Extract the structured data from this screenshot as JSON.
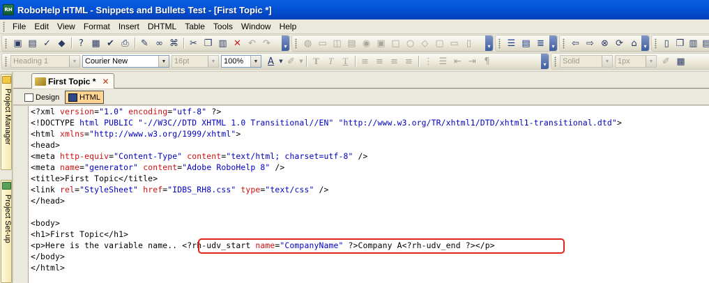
{
  "window": {
    "app_icon_text": "RH",
    "title": "RoboHelp HTML - Snippets and Bullets Test - [First Topic *]"
  },
  "menu": [
    "File",
    "Edit",
    "View",
    "Format",
    "Insert",
    "DHTML",
    "Table",
    "Tools",
    "Window",
    "Help"
  ],
  "toolbar_format": {
    "style_value": "Heading 1",
    "font_value": "Courier New",
    "size_value": "16pt",
    "zoom_value": "100%",
    "border_style_value": "Solid",
    "border_width_value": "1px"
  },
  "left_panels": {
    "project_manager": "Project Manager",
    "project_setup": "Project Set-up"
  },
  "document_tab": {
    "label": "First Topic *",
    "close_glyph": "✕"
  },
  "view_switch": {
    "design_label": "Design",
    "html_label": "HTML"
  },
  "code": {
    "lines": [
      [
        [
          "tag",
          "<?xml "
        ],
        [
          "attr",
          "version"
        ],
        [
          "tag",
          "="
        ],
        [
          "val",
          "\"1.0\""
        ],
        [
          "tag",
          " "
        ],
        [
          "attr",
          "encoding"
        ],
        [
          "tag",
          "="
        ],
        [
          "val",
          "\"utf-8\""
        ],
        [
          "tag",
          " ?>"
        ]
      ],
      [
        [
          "tag",
          "<!DOCTYPE "
        ],
        [
          "decl",
          "html PUBLIC \"-//W3C//DTD XHTML 1.0 Transitional//EN\" \"http://www.w3.org/TR/xhtml1/DTD/xhtml1-transitional.dtd\""
        ],
        [
          "tag",
          ">"
        ]
      ],
      [
        [
          "tag",
          "<html "
        ],
        [
          "attr",
          "xmlns"
        ],
        [
          "tag",
          "="
        ],
        [
          "val",
          "\"http://www.w3.org/1999/xhtml\""
        ],
        [
          "tag",
          ">"
        ]
      ],
      [
        [
          "tag",
          "<head>"
        ]
      ],
      [
        [
          "tag",
          "<meta "
        ],
        [
          "attr",
          "http-equiv"
        ],
        [
          "tag",
          "="
        ],
        [
          "val",
          "\"Content-Type\""
        ],
        [
          "tag",
          " "
        ],
        [
          "attr",
          "content"
        ],
        [
          "tag",
          "="
        ],
        [
          "val",
          "\"text/html; charset=utf-8\""
        ],
        [
          "tag",
          " />"
        ]
      ],
      [
        [
          "tag",
          "<meta "
        ],
        [
          "attr",
          "name"
        ],
        [
          "tag",
          "="
        ],
        [
          "val",
          "\"generator\""
        ],
        [
          "tag",
          " "
        ],
        [
          "attr",
          "content"
        ],
        [
          "tag",
          "="
        ],
        [
          "val",
          "\"Adobe RoboHelp 8\""
        ],
        [
          "tag",
          " />"
        ]
      ],
      [
        [
          "tag",
          "<title>First Topic</title>"
        ]
      ],
      [
        [
          "tag",
          "<link "
        ],
        [
          "attr",
          "rel"
        ],
        [
          "tag",
          "="
        ],
        [
          "val",
          "\"StyleSheet\""
        ],
        [
          "tag",
          " "
        ],
        [
          "attr",
          "href"
        ],
        [
          "tag",
          "="
        ],
        [
          "val",
          "\"IDBS_RH8.css\""
        ],
        [
          "tag",
          " "
        ],
        [
          "attr",
          "type"
        ],
        [
          "tag",
          "="
        ],
        [
          "val",
          "\"text/css\""
        ],
        [
          "tag",
          " />"
        ]
      ],
      [
        [
          "tag",
          "</head>"
        ]
      ],
      [
        [
          "tag",
          ""
        ]
      ],
      [
        [
          "tag",
          "<body>"
        ]
      ],
      [
        [
          "tag",
          "<h1>First Topic</h1>"
        ]
      ],
      [
        [
          "tag",
          "<p>Here is the variable name.. <?rh-udv_start "
        ],
        [
          "attr",
          "name"
        ],
        [
          "tag",
          "="
        ],
        [
          "val",
          "\"CompanyName\""
        ],
        [
          "tag",
          " ?>Company A<?rh-udv_end ?></p>"
        ]
      ],
      [
        [
          "tag",
          "</body>"
        ]
      ],
      [
        [
          "tag",
          "</html>"
        ]
      ]
    ]
  },
  "highlight_color": "#e0221a"
}
